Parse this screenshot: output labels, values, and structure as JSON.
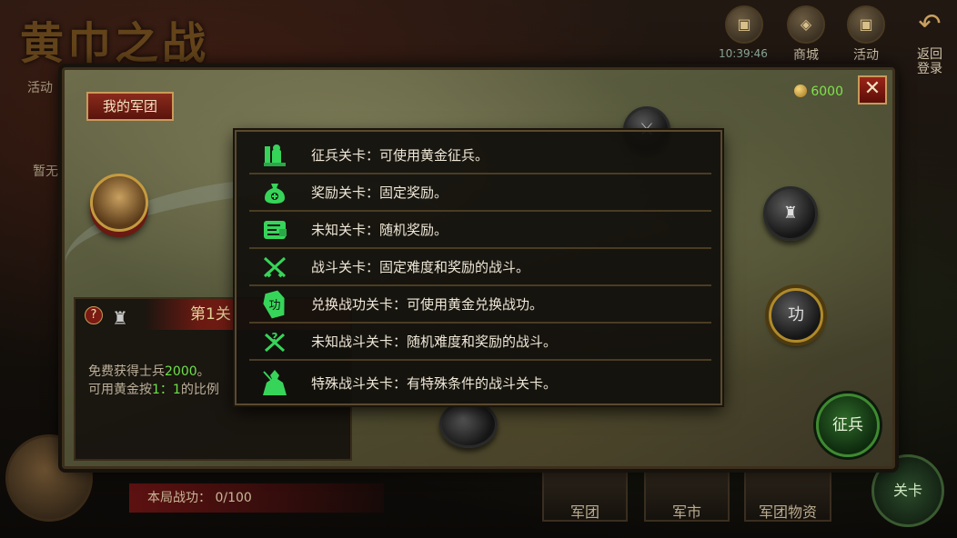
{
  "top_bar": {
    "title": "黄巾之战",
    "clock": "10:39:46",
    "shop_label": "商城",
    "events_label": "活动",
    "back_label": "返回\n登录"
  },
  "side": {
    "events_label": "活动",
    "partial_label": "暂无"
  },
  "panel": {
    "army_button": "我的军团",
    "gold_amount": "6000",
    "close_symbol": "✕",
    "recruit_button": "征兵"
  },
  "info_box": {
    "stage_title": "第1关",
    "help_symbol": "?",
    "line1_prefix": "免费获得士兵",
    "line1_value": "2000",
    "line1_suffix": "。",
    "line2_prefix": "可用黄金按",
    "line2_ratio": "1：1",
    "line2_suffix": "的比例"
  },
  "legend": {
    "items": [
      {
        "icon": "recruit-icon",
        "label": "征兵关卡：可使用黄金征兵。"
      },
      {
        "icon": "money-bag-icon",
        "label": "奖励关卡：固定奖励。"
      },
      {
        "icon": "unknown-scroll-icon",
        "label": "未知关卡：随机奖励。"
      },
      {
        "icon": "crossed-swords-icon",
        "label": "战斗关卡：固定难度和奖励的战斗。"
      },
      {
        "icon": "merit-token-icon",
        "label": "兑换战功关卡：可使用黄金兑换战功。"
      },
      {
        "icon": "unknown-swords-icon",
        "label": "未知战斗关卡：随机难度和奖励的战斗。"
      },
      {
        "icon": "special-warrior-icon",
        "label": "特殊战斗关卡：有特殊条件的战斗关卡。"
      }
    ],
    "icon_color": "#37d45a"
  },
  "bottom_bar": {
    "score_label": "本局战功：",
    "score_value": "0/100",
    "tab_army": "军团",
    "tab_market": "军市",
    "tab_supplies": "军团物资",
    "stage_button": "关卡"
  }
}
